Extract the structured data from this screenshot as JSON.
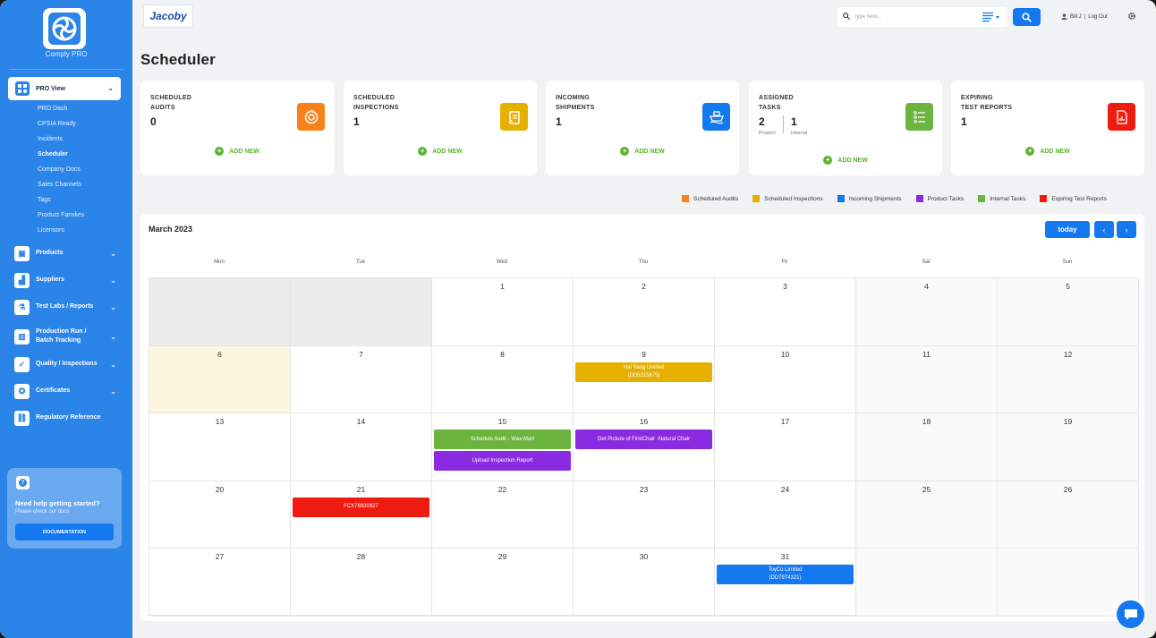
{
  "app": {
    "logo_text": "Comply PRO",
    "brand_logo": "Jacoby"
  },
  "sidebar": {
    "pro_view_label": "PRO View",
    "sub_items": [
      {
        "label": "PRO Dash"
      },
      {
        "label": "CPSIA Ready"
      },
      {
        "label": "Incidents"
      },
      {
        "label": "Scheduler",
        "active": true
      },
      {
        "label": "Company Docs"
      },
      {
        "label": "Sales Channels"
      },
      {
        "label": "Tags"
      },
      {
        "label": "Product Families"
      },
      {
        "label": "Licensors"
      }
    ],
    "nav_items": [
      {
        "label": "Products",
        "icon": "box-icon"
      },
      {
        "label": "Suppliers",
        "icon": "factory-icon"
      },
      {
        "label": "Test Labs / Reports",
        "icon": "flask-icon"
      },
      {
        "label": "Production Run / Batch Tracking",
        "icon": "barcode-icon"
      },
      {
        "label": "Quality / Inspections",
        "icon": "inspection-icon"
      },
      {
        "label": "Certificates",
        "icon": "certificate-icon"
      },
      {
        "label": "Regulatory Reference",
        "icon": "link-icon"
      }
    ],
    "help": {
      "title": "Need help getting started?",
      "subtitle": "Please check our docs",
      "button": "DOCUMENTATION"
    }
  },
  "topbar": {
    "search_placeholder": "Type here...",
    "user_name": "Bill J",
    "separator": "|",
    "logout": "Log Out"
  },
  "page_title": "Scheduler",
  "cards": [
    {
      "title_line1": "SCHEDULED",
      "title_line2": "AUDITS",
      "count": "0",
      "icon": "audit-icon",
      "color": "#f7821b",
      "add": "ADD NEW"
    },
    {
      "title_line1": "SCHEDULED",
      "title_line2": "INSPECTIONS",
      "count": "1",
      "icon": "clipboard-icon",
      "color": "#e6b000",
      "add": "ADD NEW"
    },
    {
      "title_line1": "INCOMING",
      "title_line2": "SHIPMENTS",
      "count": "1",
      "icon": "ship-icon",
      "color": "#1478f0",
      "add": "ADD NEW"
    },
    {
      "title_line1": "ASSIGNED",
      "title_line2": "TASKS",
      "product_count": "2",
      "product_label": "Product",
      "internal_count": "1",
      "internal_label": "Internal",
      "icon": "list-icon",
      "color": "#6db33f",
      "add": "ADD NEW"
    },
    {
      "title_line1": "EXPIRING",
      "title_line2": "TEST REPORTS",
      "count": "1",
      "icon": "report-icon",
      "color": "#ee1c10",
      "add": "ADD NEW"
    }
  ],
  "legend": [
    {
      "label": "Scheduled Audits",
      "color": "#f7821b"
    },
    {
      "label": "Scheduled Inspections",
      "color": "#e6b000"
    },
    {
      "label": "Incoming Shipments",
      "color": "#1478f0"
    },
    {
      "label": "Product Tasks",
      "color": "#8a2be2"
    },
    {
      "label": "Internal Tasks",
      "color": "#6db33f"
    },
    {
      "label": "Expiring Test Reports",
      "color": "#ee1c10"
    }
  ],
  "calendar": {
    "month": "March 2023",
    "today_label": "today",
    "prev": "‹",
    "next": "›",
    "days_of_week": [
      "Mon",
      "Tue",
      "Wed",
      "Thu",
      "Fri",
      "Sat",
      "Sun"
    ],
    "weeks": [
      [
        "",
        "",
        "1",
        "2",
        "3",
        "4",
        "5"
      ],
      [
        "6",
        "7",
        "8",
        "9",
        "10",
        "11",
        "12"
      ],
      [
        "13",
        "14",
        "15",
        "16",
        "17",
        "18",
        "19"
      ],
      [
        "20",
        "21",
        "22",
        "23",
        "24",
        "25",
        "26"
      ],
      [
        "27",
        "28",
        "29",
        "30",
        "31",
        "",
        ""
      ]
    ],
    "today_date": "6",
    "events": [
      {
        "week": 1,
        "day": 3,
        "slot": 0,
        "line1": "Hai Yang Limited",
        "line2": "(DD5315875)",
        "color": "#e6b000"
      },
      {
        "week": 2,
        "day": 2,
        "slot": 0,
        "line1": "Schedule Audit - Wax-Mart",
        "line2": "",
        "color": "#6db33f"
      },
      {
        "week": 2,
        "day": 2,
        "slot": 1,
        "line1": "Upload Inspection Report",
        "line2": "",
        "color": "#8a2be2"
      },
      {
        "week": 2,
        "day": 3,
        "slot": 0,
        "line1": "Get Picture of FirstChair -Natural Chair",
        "line2": "",
        "color": "#8a2be2"
      },
      {
        "week": 3,
        "day": 1,
        "slot": 0,
        "line1": "FCX76930927",
        "line2": "",
        "color": "#ee1c10"
      },
      {
        "week": 4,
        "day": 4,
        "slot": 0,
        "line1": "ToyCo Limited",
        "line2": "(DD7974321)",
        "color": "#1478f0"
      }
    ]
  }
}
